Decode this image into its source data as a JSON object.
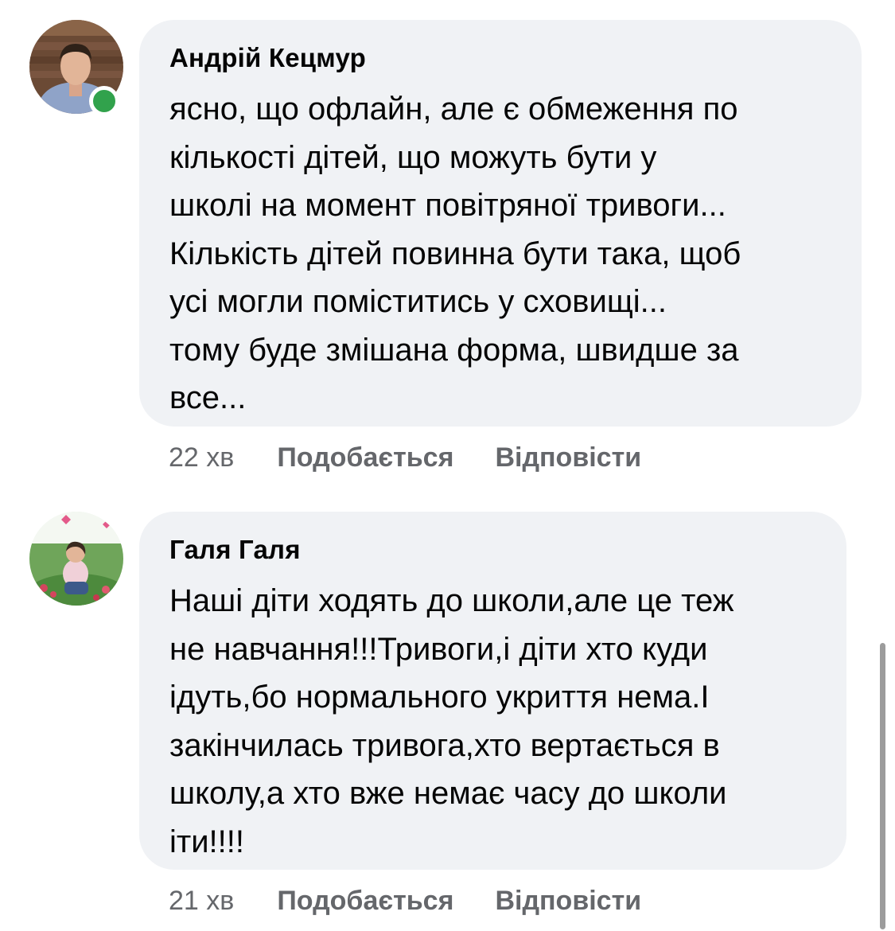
{
  "comments": [
    {
      "author": "Андрій Кецмур",
      "online": true,
      "text": "ясно, що офлайн, але є обмеження по\nкількості дітей, що можуть бути у\nшколі на момент повітряної тривоги...\nКількість дітей повинна бути така, щоб\nусі могли поміститись у сховищі...\nтому буде змішана форма, швидше за\nвсе...",
      "time": "22 хв",
      "like_label": "Подобається",
      "reply_label": "Відповісти"
    },
    {
      "author": "Галя Галя",
      "online": false,
      "text": "Наші діти ходять до школи,але це теж\nне навчання!!!Тривоги,і діти хто куди\nідуть,бо нормального укриття нема.І\nзакінчилась тривога,хто вертається в\nшколу,а хто вже немає часу до школи\nіти!!!!",
      "time": "21 хв",
      "like_label": "Подобається",
      "reply_label": "Відповісти"
    }
  ],
  "colors": {
    "bubble_bg": "#f0f2f5",
    "meta_text": "#65676b",
    "online": "#31a24c",
    "text": "#050505"
  }
}
